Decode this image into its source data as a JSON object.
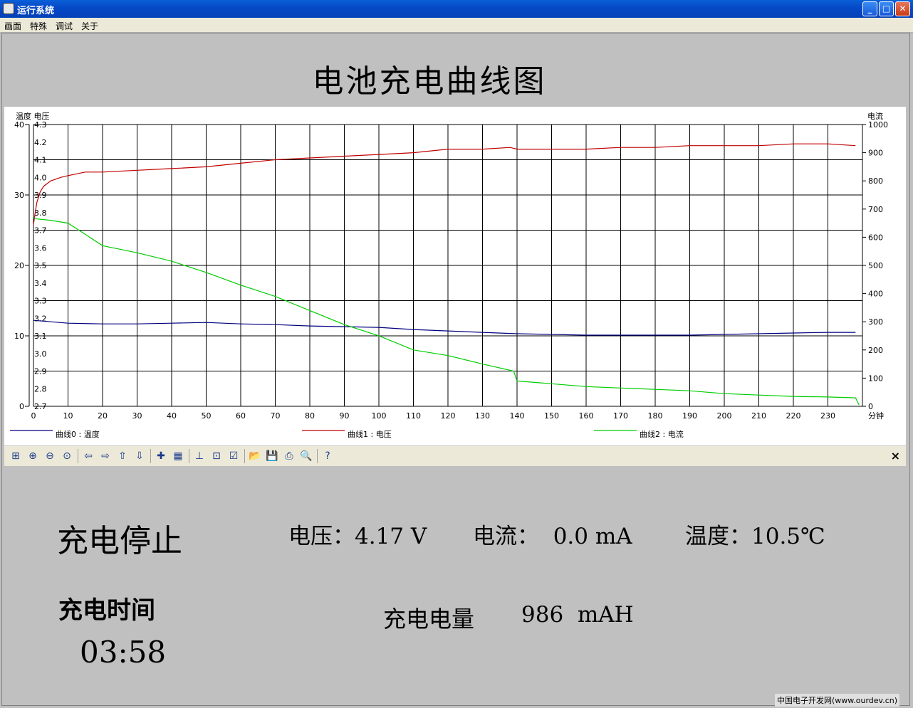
{
  "window": {
    "title": "运行系统",
    "minimize": "_",
    "maximize": "□",
    "close": "✕"
  },
  "menu": [
    "画面",
    "特殊",
    "调试",
    "关于"
  ],
  "page_title": "电池充电曲线图",
  "chart_data": {
    "type": "line",
    "left_axis_label": "温度 电压",
    "right_axis_label": "电流",
    "x_unit_label": "分钟",
    "x_range": [
      0,
      240
    ],
    "x_ticks": [
      0,
      10,
      20,
      30,
      40,
      50,
      60,
      70,
      80,
      90,
      100,
      110,
      120,
      130,
      140,
      150,
      160,
      170,
      180,
      190,
      200,
      210,
      220,
      230
    ],
    "temperature_axis": {
      "range": [
        0,
        40
      ],
      "ticks": [
        0,
        10,
        20,
        30,
        40
      ]
    },
    "voltage_axis": {
      "range": [
        2.7,
        4.3
      ],
      "ticks": [
        "2.7",
        "2.8",
        "2.9",
        "3.0",
        "3.1",
        "3.2",
        "3.3",
        "3.4",
        "3.5",
        "3.6",
        "3.7",
        "3.8",
        "3.9",
        "4.0",
        "4.1",
        "4.2",
        "4.3"
      ]
    },
    "current_axis": {
      "range": [
        0,
        1000
      ],
      "ticks": [
        0,
        100,
        200,
        300,
        400,
        500,
        600,
        700,
        800,
        900,
        1000
      ]
    },
    "grid": true,
    "series": [
      {
        "name": "曲线0 : 温度",
        "axis": "temperature",
        "color": "#00007f",
        "x": [
          0,
          5,
          10,
          20,
          30,
          40,
          50,
          60,
          70,
          80,
          90,
          100,
          110,
          120,
          130,
          140,
          150,
          160,
          170,
          180,
          190,
          200,
          210,
          220,
          230,
          238
        ],
        "y": [
          12.2,
          12.0,
          11.8,
          11.7,
          11.7,
          11.8,
          11.9,
          11.7,
          11.6,
          11.4,
          11.3,
          11.2,
          10.9,
          10.7,
          10.5,
          10.3,
          10.2,
          10.1,
          10.1,
          10.1,
          10.1,
          10.2,
          10.3,
          10.4,
          10.5,
          10.5
        ]
      },
      {
        "name": "曲线1 : 电压",
        "axis": "voltage",
        "color": "#c00000",
        "x": [
          0,
          0.5,
          1,
          2,
          3,
          5,
          8,
          10,
          15,
          20,
          30,
          40,
          50,
          60,
          70,
          80,
          90,
          100,
          110,
          120,
          130,
          138,
          140,
          150,
          160,
          170,
          180,
          190,
          200,
          210,
          220,
          230,
          238
        ],
        "y": [
          3.73,
          3.8,
          3.86,
          3.92,
          3.95,
          3.98,
          4.0,
          4.01,
          4.03,
          4.03,
          4.04,
          4.05,
          4.06,
          4.08,
          4.1,
          4.11,
          4.12,
          4.13,
          4.14,
          4.16,
          4.16,
          4.17,
          4.16,
          4.16,
          4.16,
          4.17,
          4.17,
          4.18,
          4.18,
          4.18,
          4.19,
          4.19,
          4.18
        ]
      },
      {
        "name": "曲线2 : 电流",
        "axis": "current",
        "color": "#00cc00",
        "x": [
          0,
          1,
          5,
          10,
          15,
          20,
          30,
          40,
          50,
          60,
          70,
          80,
          90,
          100,
          110,
          120,
          130,
          139,
          140,
          150,
          160,
          170,
          180,
          190,
          200,
          210,
          220,
          230,
          238,
          239
        ],
        "y": [
          670,
          665,
          660,
          650,
          610,
          570,
          545,
          515,
          475,
          430,
          390,
          340,
          290,
          250,
          200,
          180,
          150,
          125,
          90,
          80,
          70,
          65,
          60,
          55,
          45,
          40,
          35,
          33,
          30,
          5
        ]
      }
    ]
  },
  "toolbar": {
    "icons": [
      "zoom-region-icon",
      "zoom-in-icon",
      "zoom-out-icon",
      "zoom-reset-icon",
      "pan-left-icon",
      "pan-right-icon",
      "pan-up-icon",
      "pan-down-icon",
      "cursor-icon",
      "grid-icon",
      "axis-icon",
      "select-icon",
      "properties-icon",
      "open-icon",
      "save-icon",
      "print-icon",
      "print-preview-icon",
      "help-icon"
    ],
    "glyphs": [
      "⊞",
      "⊕",
      "⊖",
      "⊙",
      "⇦",
      "⇨",
      "⇧",
      "⇩",
      "✚",
      "▦",
      "⊥",
      "⊡",
      "☑",
      "📂",
      "💾",
      "⎙",
      "🔍",
      "?"
    ],
    "close": "×"
  },
  "status": {
    "state": "充电停止",
    "voltage": "电压：4.17 V",
    "current": "电流：  0.0 mA",
    "temperature": "温度：10.5℃",
    "charge_time_label": "充电时间",
    "charge_time": "03:58",
    "capacity_label": "充电电量",
    "capacity_value": "986  mAH"
  },
  "watermark": "中国电子开发网(www.ourdev.cn)"
}
